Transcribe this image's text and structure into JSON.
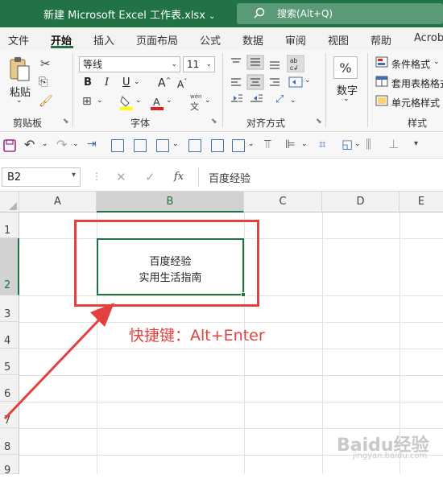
{
  "window": {
    "title": "新建 Microsoft Excel 工作表.xlsx",
    "search_placeholder": "搜索(Alt+Q)"
  },
  "tabs": [
    "文件",
    "开始",
    "插入",
    "页面布局",
    "公式",
    "数据",
    "审阅",
    "视图",
    "帮助",
    "Acrob"
  ],
  "active_tab": "开始",
  "ribbon": {
    "clipboard": {
      "paste_label": "粘贴",
      "group_label": "剪贴板"
    },
    "font": {
      "font_name": "等线",
      "font_size": "11",
      "group_label": "字体",
      "phonetic_label": "wén",
      "phonetic_char": "文"
    },
    "alignment": {
      "group_label": "对齐方式"
    },
    "number": {
      "label": "数字",
      "symbol": "%"
    },
    "styles": {
      "conditional_format": "条件格式",
      "table_format": "套用表格格式",
      "cell_styles": "单元格样式",
      "group_label": "样式"
    }
  },
  "formula_bar": {
    "name_box": "B2",
    "fx_label": "fx",
    "content": "百度经验"
  },
  "columns": [
    "A",
    "B",
    "C",
    "D",
    "E"
  ],
  "rows": [
    "1",
    "2",
    "3",
    "4",
    "5",
    "6",
    "7",
    "8",
    "9"
  ],
  "cell_b2": {
    "line1": "百度经验",
    "line2": "实用生活指南"
  },
  "annotation": "快捷键：Alt+Enter",
  "watermark": {
    "text": "Baidu经验",
    "sub": "jingyan.baidu.com"
  },
  "colors": {
    "accent": "#217346",
    "annotation_red": "#e4413e"
  }
}
